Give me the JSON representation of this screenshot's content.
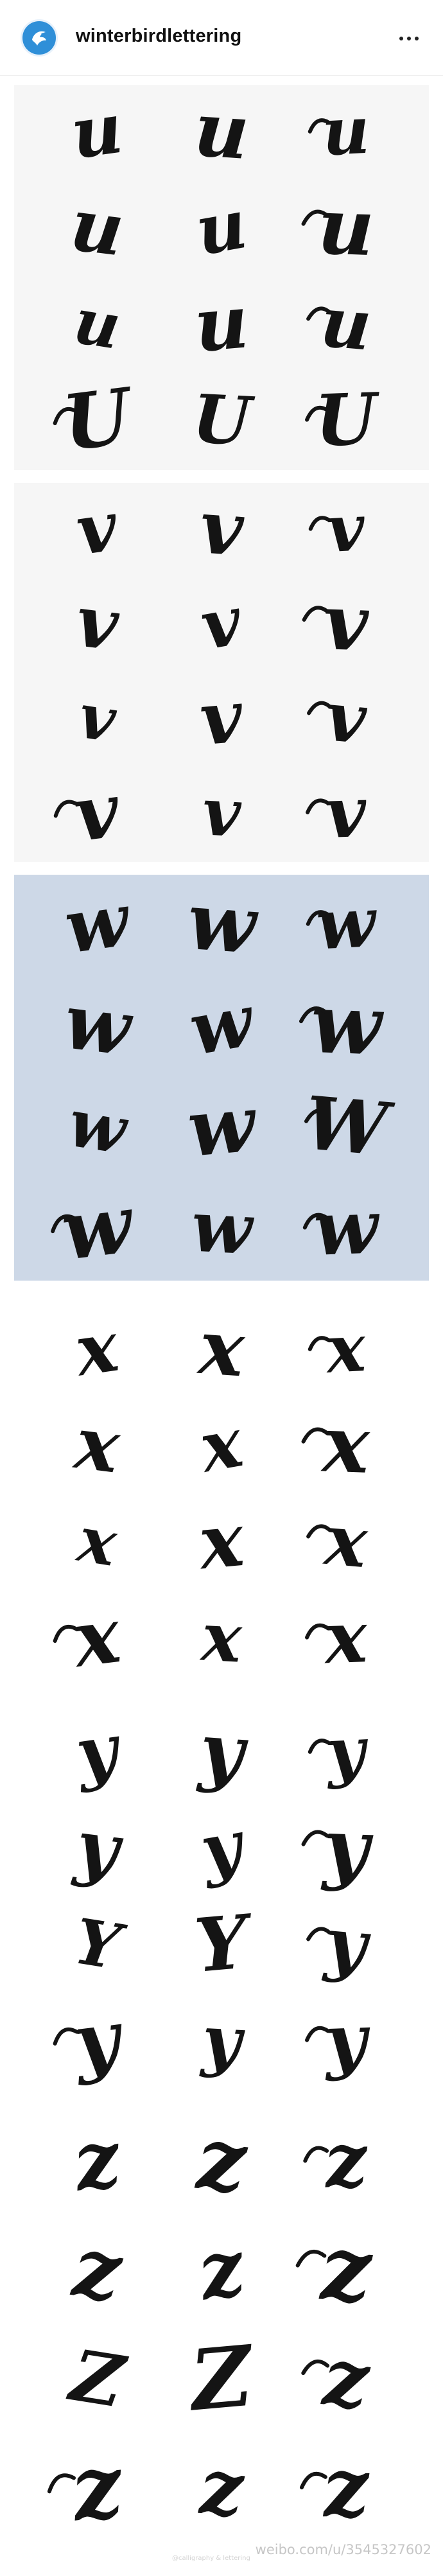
{
  "header": {
    "username": "winterbirdlettering",
    "avatar_icon": "bird-logo-icon",
    "more_icon": "more-horizontal-icon"
  },
  "panels": [
    {
      "id": "u",
      "background": "#f6f6f6",
      "glyph_rows": [
        [
          "u",
          "u",
          "u"
        ],
        [
          "u",
          "u",
          "u"
        ],
        [
          "u",
          "u",
          "u"
        ],
        [
          "U",
          "U",
          "U"
        ]
      ]
    },
    {
      "id": "v",
      "background": "#f6f6f6",
      "glyph_rows": [
        [
          "v",
          "v",
          "v"
        ],
        [
          "v",
          "v",
          "v"
        ],
        [
          "v",
          "v",
          "v"
        ],
        [
          "v",
          "v",
          "v"
        ]
      ]
    },
    {
      "id": "w",
      "background": "#cdd8e7",
      "glyph_rows": [
        [
          "w",
          "w",
          "w"
        ],
        [
          "w",
          "w",
          "w"
        ],
        [
          "w",
          "w",
          "W"
        ],
        [
          "w",
          "w",
          "w"
        ]
      ]
    },
    {
      "id": "x",
      "background": "#ffffff",
      "glyph_rows": [
        [
          "x",
          "x",
          "x"
        ],
        [
          "x",
          "x",
          "x"
        ],
        [
          "x",
          "x",
          "x"
        ],
        [
          "x",
          "x",
          "x"
        ]
      ]
    },
    {
      "id": "y",
      "background": "#ffffff",
      "glyph_rows": [
        [
          "y",
          "y",
          "y"
        ],
        [
          "y",
          "y",
          "y"
        ],
        [
          "Y",
          "Y",
          "y"
        ],
        [
          "y",
          "y",
          "y"
        ]
      ]
    },
    {
      "id": "z",
      "background": "#ffffff",
      "glyph_rows": [
        [
          "z",
          "z",
          "z"
        ],
        [
          "z",
          "z",
          "z"
        ],
        [
          "Z",
          "Z",
          "z"
        ],
        [
          "z",
          "z",
          "z"
        ]
      ]
    }
  ],
  "watermark": {
    "main": "weibo.com/u/3545327602",
    "small": "@calligraphy & lettering"
  }
}
